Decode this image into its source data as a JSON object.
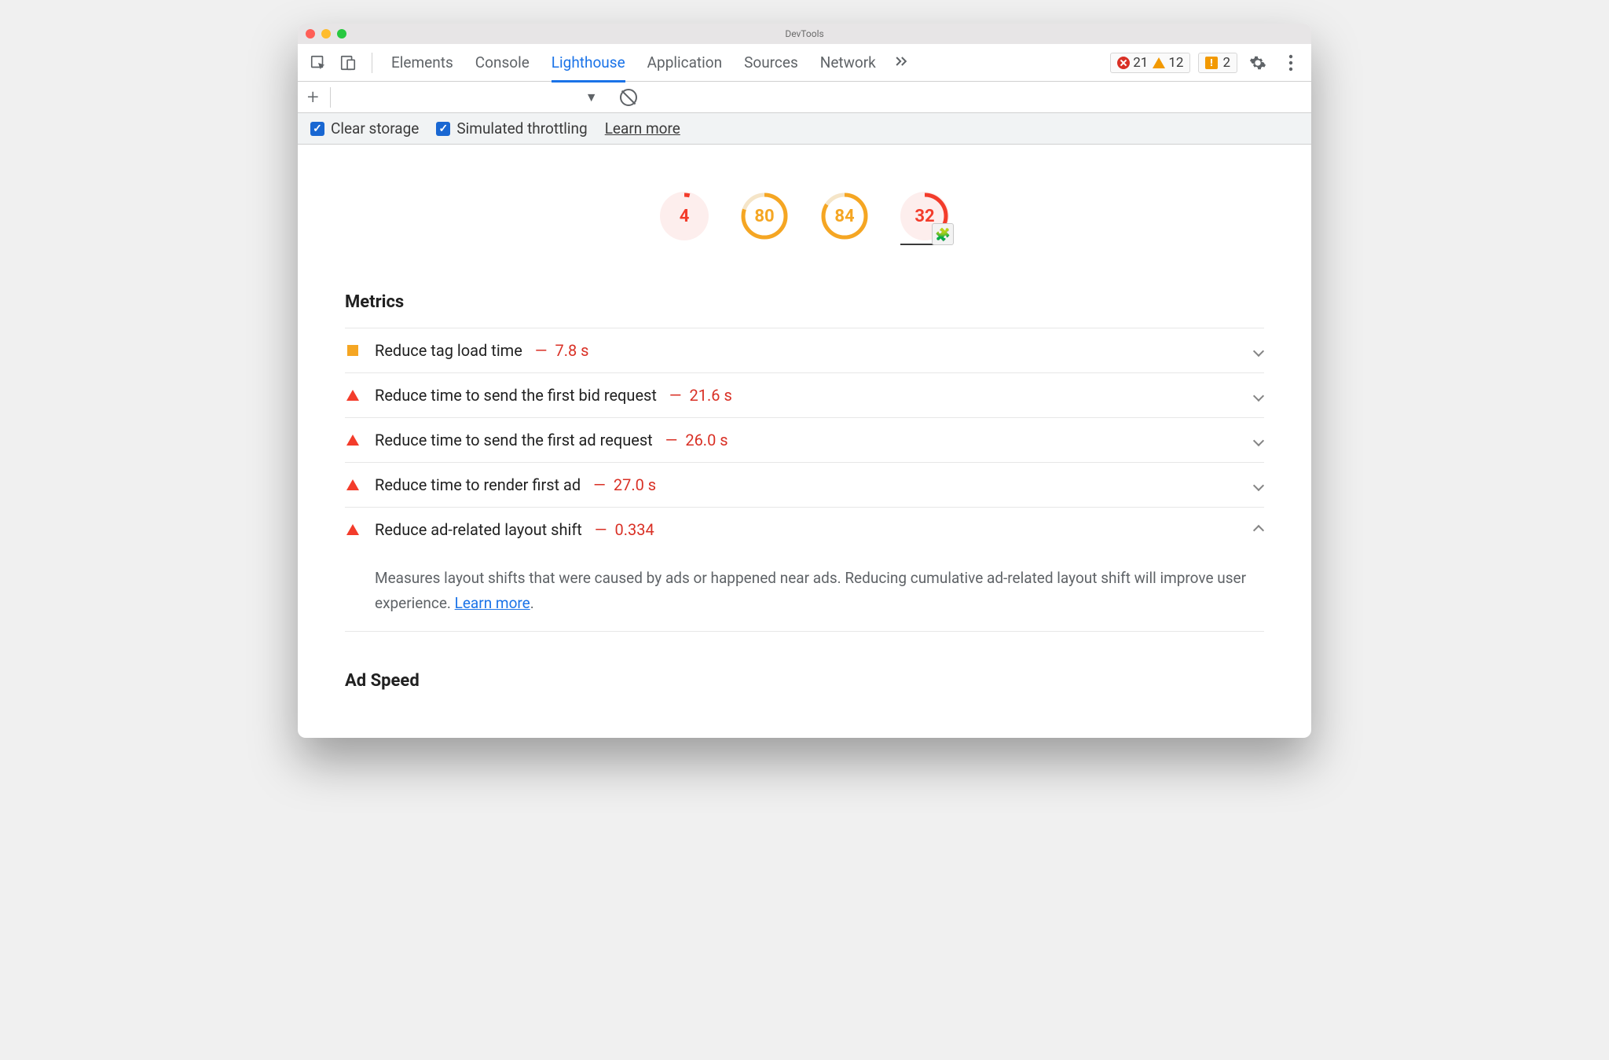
{
  "window_title": "DevTools",
  "tabs": [
    "Elements",
    "Console",
    "Lighthouse",
    "Application",
    "Sources",
    "Network"
  ],
  "active_tab": "Lighthouse",
  "counters": {
    "errors": "21",
    "warnings": "12",
    "issues": "2"
  },
  "settings": {
    "clear_storage": "Clear storage",
    "simulated_throttling": "Simulated throttling",
    "learn_more": "Learn more"
  },
  "scores": [
    {
      "value": "4",
      "color": "red",
      "pct": 4
    },
    {
      "value": "80",
      "color": "orange",
      "pct": 80
    },
    {
      "value": "84",
      "color": "orange",
      "pct": 84
    },
    {
      "value": "32",
      "color": "red",
      "pct": 32,
      "plugin": true,
      "selected": true
    }
  ],
  "section_metrics": "Metrics",
  "audits": [
    {
      "icon": "square",
      "label": "Reduce tag load time",
      "value": "7.8 s",
      "open": false
    },
    {
      "icon": "triangle",
      "label": "Reduce time to send the first bid request",
      "value": "21.6 s",
      "open": false
    },
    {
      "icon": "triangle",
      "label": "Reduce time to send the first ad request",
      "value": "26.0 s",
      "open": false
    },
    {
      "icon": "triangle",
      "label": "Reduce time to render first ad",
      "value": "27.0 s",
      "open": false
    },
    {
      "icon": "triangle",
      "label": "Reduce ad-related layout shift",
      "value": "0.334",
      "open": true
    }
  ],
  "open_audit_desc": "Measures layout shifts that were caused by ads or happened near ads. Reducing cumulative ad-related layout shift will improve user experience. ",
  "open_audit_learn": "Learn more",
  "section_adspeed": "Ad Speed"
}
